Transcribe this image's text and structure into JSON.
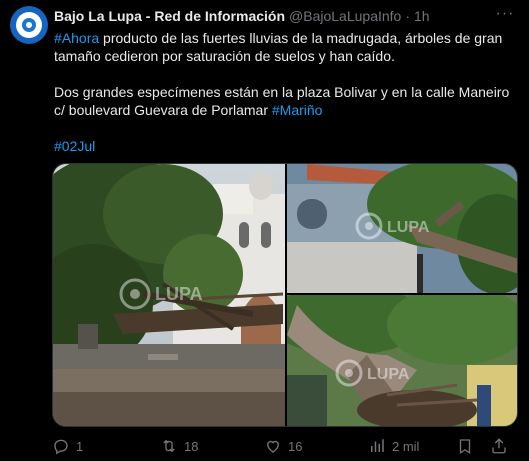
{
  "author": {
    "display_name": "Bajo La Lupa - Red de Información",
    "handle": "@BajoLaLupaInfo",
    "separator": "·",
    "time": "1h",
    "avatar_icon": "magnifier-eye-logo"
  },
  "more_icon": "more-horizontal-icon",
  "text": {
    "p1_hashtag": "#Ahora",
    "p1_rest": " producto de las fuertes lluvias de la madrugada, árboles de gran tamaño cedieron por saturación de suelos y han caído.",
    "p2_text": "Dos grandes especímenes están en la plaza Bolivar y en la calle Maneiro c/ boulevard Guevara de Porlamar ",
    "p2_hashtag": "#Mariño",
    "p3_hashtag": "#02Jul"
  },
  "media": {
    "watermark": "LUPA",
    "photos": [
      "fallen-tree-plaza-church",
      "fallen-tree-on-building",
      "fallen-tree-trunk-closeup"
    ]
  },
  "actions": {
    "reply_count": "1",
    "retweet_count": "18",
    "like_count": "16",
    "views_count": "2 mil"
  },
  "colors": {
    "background": "#000000",
    "text": "#e7e9ea",
    "muted": "#71767b",
    "link": "#1d9bf0",
    "avatar": "#1565c0"
  }
}
